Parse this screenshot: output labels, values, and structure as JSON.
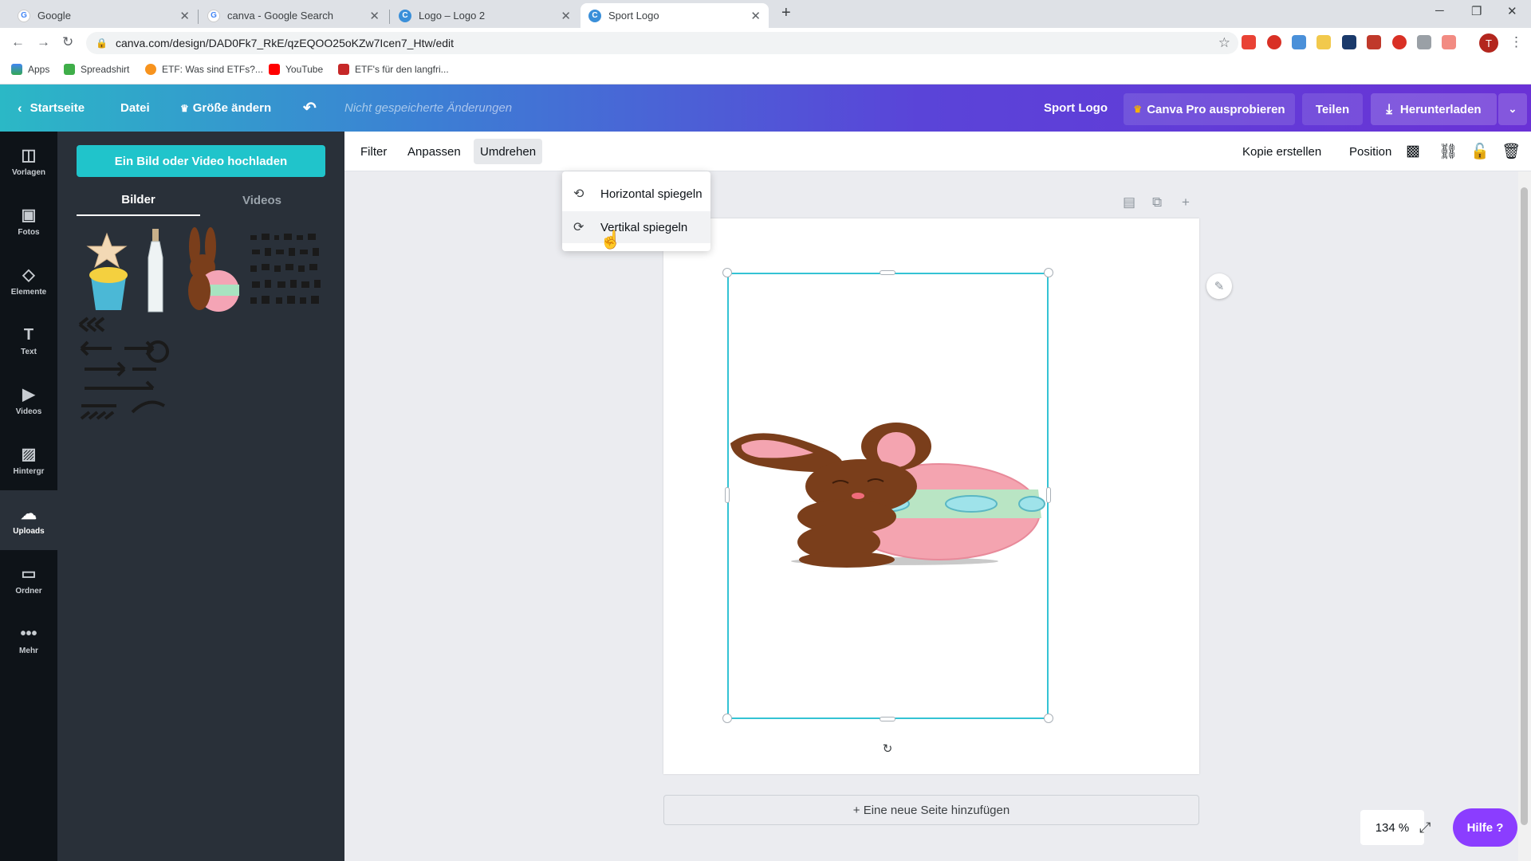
{
  "browser": {
    "tabs": [
      {
        "title": "Google",
        "icon": "google-icon",
        "active": false
      },
      {
        "title": "canva - Google Search",
        "icon": "google-icon",
        "active": false
      },
      {
        "title": "Logo – Logo 2",
        "icon": "canva-icon",
        "active": false
      },
      {
        "title": "Sport Logo",
        "icon": "canva-icon",
        "active": true
      }
    ],
    "url": "canva.com/design/DAD0Fk7_RkE/qzEQOO25oKZw7Icen7_Htw/edit",
    "bookmarks": [
      "Apps",
      "Spreadshirt",
      "ETF: Was sind ETFs?...",
      "YouTube",
      "ETF's für den langfri..."
    ],
    "profile_initial": "T"
  },
  "header": {
    "home": "Startseite",
    "file": "Datei",
    "resize": "Größe ändern",
    "status": "Nicht gespeicherte Änderungen",
    "design_title": "Sport Logo",
    "pro": "Canva Pro ausprobieren",
    "share": "Teilen",
    "download": "Herunterladen",
    "accent": "#8b3dff"
  },
  "rail": [
    {
      "label": "Vorlagen",
      "icon": "templates-icon"
    },
    {
      "label": "Fotos",
      "icon": "photos-icon"
    },
    {
      "label": "Elemente",
      "icon": "elements-icon"
    },
    {
      "label": "Text",
      "icon": "text-icon"
    },
    {
      "label": "Videos",
      "icon": "videos-icon"
    },
    {
      "label": "Hintergr",
      "icon": "background-icon"
    },
    {
      "label": "Uploads",
      "icon": "uploads-icon"
    },
    {
      "label": "Ordner",
      "icon": "folder-icon"
    },
    {
      "label": "Mehr",
      "icon": "more-icon"
    }
  ],
  "panel": {
    "upload_button": "Ein Bild oder Video hochladen",
    "tabs": [
      "Bilder",
      "Videos"
    ],
    "active_tab": "Bilder"
  },
  "toolbar": {
    "filter": "Filter",
    "adjust": "Anpassen",
    "flip": "Umdrehen",
    "copy": "Kopie erstellen",
    "position": "Position"
  },
  "flip_menu": {
    "horizontal": "Horizontal spiegeln",
    "vertical": "Vertikal spiegeln"
  },
  "canvas": {
    "add_page": "+ Eine neue Seite hinzufügen",
    "zoom": "134 %",
    "help": "Hilfe ?",
    "selection_color": "#34c3d4"
  }
}
